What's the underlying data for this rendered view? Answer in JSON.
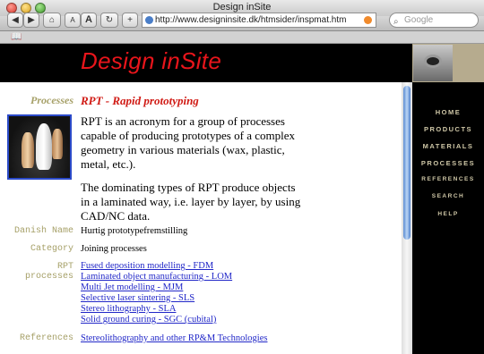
{
  "window": {
    "title": "Design inSite"
  },
  "toolbar": {
    "back": "◀",
    "forward": "▶",
    "home": "⌂",
    "text_small": "A",
    "text_large": "A",
    "reload": "↻",
    "add": "+",
    "url": "http://www.designinsite.dk/htmsider/inspmat.htm",
    "search_placeholder": "Google"
  },
  "bookmarks": {
    "icon": "📖"
  },
  "site": {
    "logo": "Design inSite"
  },
  "content": {
    "section_label": "Processes",
    "title": "RPT - Rapid prototyping",
    "paragraph1": "RPT is an acronym for a group of processes capable of producing prototypes of a complex geometry in various materials (wax, plastic, metal, etc.).",
    "paragraph2": "The dominating types of RPT produce objects in a laminated way, i.e. layer by layer, by using CAD/NC data.",
    "danish_label": "Danish Name",
    "danish_value": "Hurtig prototypefremstilling",
    "category_label": "Category",
    "category_value": "Joining processes",
    "rpt_label_1": "RPT",
    "rpt_label_2": "processes",
    "processes": [
      "Fused deposition modelling - FDM",
      "Laminated object manufacturing - LOM",
      "Multi Jet modelling - MJM",
      "Selective laser sintering - SLS",
      "Stereo lithography - SLA",
      "Solid ground curing - SGC (cubital)"
    ],
    "references_label": "References",
    "references_value": "Stereolithography and other RP&M Technologies"
  },
  "nav": [
    "HOME",
    "PRODUCTS",
    "MATERIALS",
    "PROCESSES",
    "REFERENCES",
    "SEARCH",
    "HELP"
  ],
  "colors": {
    "logo": "#e8151b",
    "label": "#a6a068",
    "title": "#d01a14",
    "link": "#2127c8",
    "nav_text": "#cfc7a7"
  }
}
